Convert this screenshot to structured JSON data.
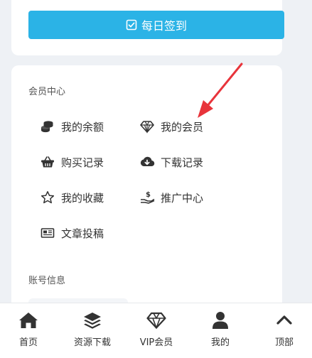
{
  "checkin": {
    "label": "每日签到",
    "icon": "checkbox-icon"
  },
  "member_center": {
    "title": "会员中心",
    "items": [
      {
        "label": "我的余额",
        "icon": "coins-icon"
      },
      {
        "label": "我的会员",
        "icon": "diamond-icon"
      },
      {
        "label": "购买记录",
        "icon": "basket-icon"
      },
      {
        "label": "下载记录",
        "icon": "cloud-download-icon"
      },
      {
        "label": "我的收藏",
        "icon": "star-icon"
      },
      {
        "label": "推广中心",
        "icon": "hand-coin-icon"
      },
      {
        "label": "文章投稿",
        "icon": "newspaper-icon"
      }
    ]
  },
  "account_info": {
    "title": "账号信息"
  },
  "tabbar": {
    "items": [
      {
        "label": "首页",
        "icon": "home-icon"
      },
      {
        "label": "资源下载",
        "icon": "layers-icon"
      },
      {
        "label": "VIP会员",
        "icon": "diamond-icon"
      },
      {
        "label": "我的",
        "icon": "user-icon"
      },
      {
        "label": "顶部",
        "icon": "chevron-up-icon"
      }
    ]
  },
  "colors": {
    "accent": "#2bb3e6",
    "arrow": "#e8343b",
    "text": "#333333",
    "background": "#eef1f5"
  }
}
